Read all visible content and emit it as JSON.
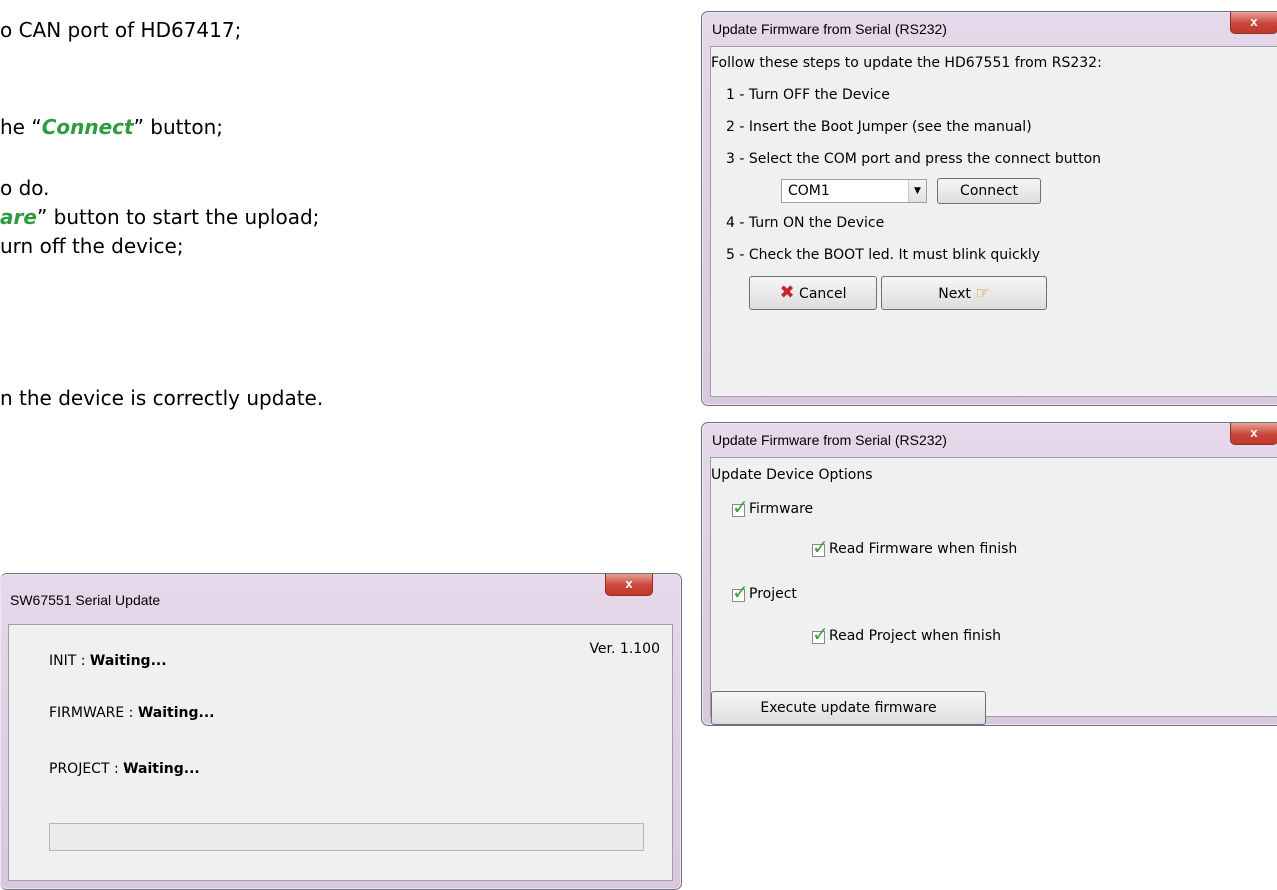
{
  "doc": {
    "line1": "o CAN port of HD67417;",
    "line2_pre": "he “",
    "line2_hl": "Connect",
    "line2_post": "” button;",
    "line3": "o do.",
    "line4_hl": "are",
    "line4_post": "” button to start the upload;",
    "line5": "urn off the device;",
    "line6": "n the device is correctly update."
  },
  "win_steps": {
    "title": "Update Firmware from Serial (RS232)",
    "close": "x",
    "intro": "Follow these steps to update the HD67551 from RS232:",
    "step1": "1 - Turn OFF the Device",
    "step2": "2 - Insert the Boot Jumper (see the manual)",
    "step3": "3 - Select the  COM port and press the connect button",
    "com_value": "COM1",
    "connect": "Connect",
    "step4": "4 - Turn ON the Device",
    "step5": "5 - Check the BOOT led. It must blink quickly",
    "cancel": "Cancel",
    "next": "Next"
  },
  "win_options": {
    "title": "Update Firmware from Serial (RS232)",
    "close": "x",
    "heading": "Update Device Options",
    "firmware": "Firmware",
    "read_firmware": "Read Firmware when finish",
    "project": "Project",
    "read_project": "Read Project when finish",
    "execute": "Execute update firmware"
  },
  "win_serial": {
    "title": "SW67551 Serial Update",
    "close": "x",
    "version": "Ver. 1.100",
    "init_label": "INIT : ",
    "init_status": "Waiting...",
    "firmware_label": "FIRMWARE : ",
    "firmware_status": "Waiting...",
    "project_label": "PROJECT : ",
    "project_status": "Waiting...",
    "progress": 0
  }
}
